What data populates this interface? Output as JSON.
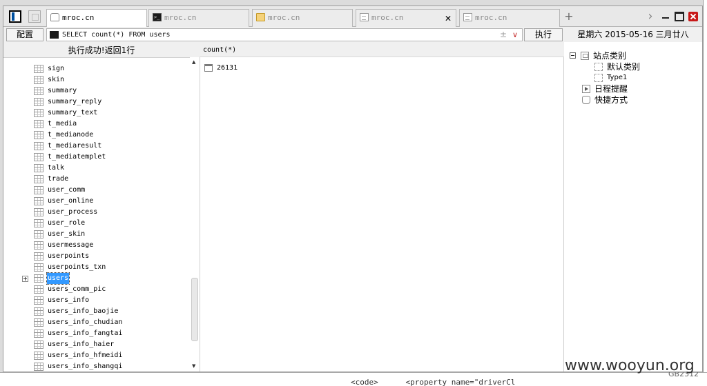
{
  "background": {
    "code_fragment": "<code>      <property name=\"driverCl",
    "encoding": "GB2312"
  },
  "tabs": [
    {
      "title": "mroc.cn",
      "icon": "page-icon",
      "active": true
    },
    {
      "title": "mroc.cn",
      "icon": "terminal-icon",
      "active": false
    },
    {
      "title": "mroc.cn",
      "icon": "folder-icon",
      "active": false
    },
    {
      "title": "mroc.cn",
      "icon": "document-icon",
      "active": false,
      "close": "✕"
    },
    {
      "title": "mroc.cn",
      "icon": "document-icon",
      "active": false
    }
  ],
  "toolbar": {
    "config_label": "配置",
    "query": "SELECT count(*) FROM users",
    "add_symbol": "±",
    "dropdown_symbol": "∨",
    "execute_label": "执行",
    "add_tab_symbol": "+",
    "next_symbol": "›"
  },
  "status": "执行成功!返回1行",
  "results": {
    "column": "count(*)",
    "rows": [
      "26131"
    ]
  },
  "tables": [
    "sign",
    "skin",
    "summary",
    "summary_reply",
    "summary_text",
    "t_media",
    "t_medianode",
    "t_mediaresult",
    "t_mediatemplet",
    "talk",
    "trade",
    "user_comm",
    "user_online",
    "user_process",
    "user_role",
    "user_skin",
    "usermessage",
    "userpoints",
    "userpoints_txn",
    "users",
    "users_comm_pic",
    "users_info",
    "users_info_baojie",
    "users_info_chudian",
    "users_info_fangtai",
    "users_info_haier",
    "users_info_hfmeidi",
    "users_info_shangqi"
  ],
  "selected_table": "users",
  "scroll": {
    "up": "▲",
    "down": "▼"
  },
  "side": {
    "date": "星期六 2015-05-16 三月廿八",
    "tree": {
      "root": "站点类别",
      "children": [
        "默认类别",
        "Type1"
      ],
      "reminders": "日程提醒",
      "shortcuts": "快捷方式"
    }
  },
  "watermark": "www.wooyun.org",
  "colors": {
    "selection": "#3399ff",
    "close": "#c81818"
  }
}
